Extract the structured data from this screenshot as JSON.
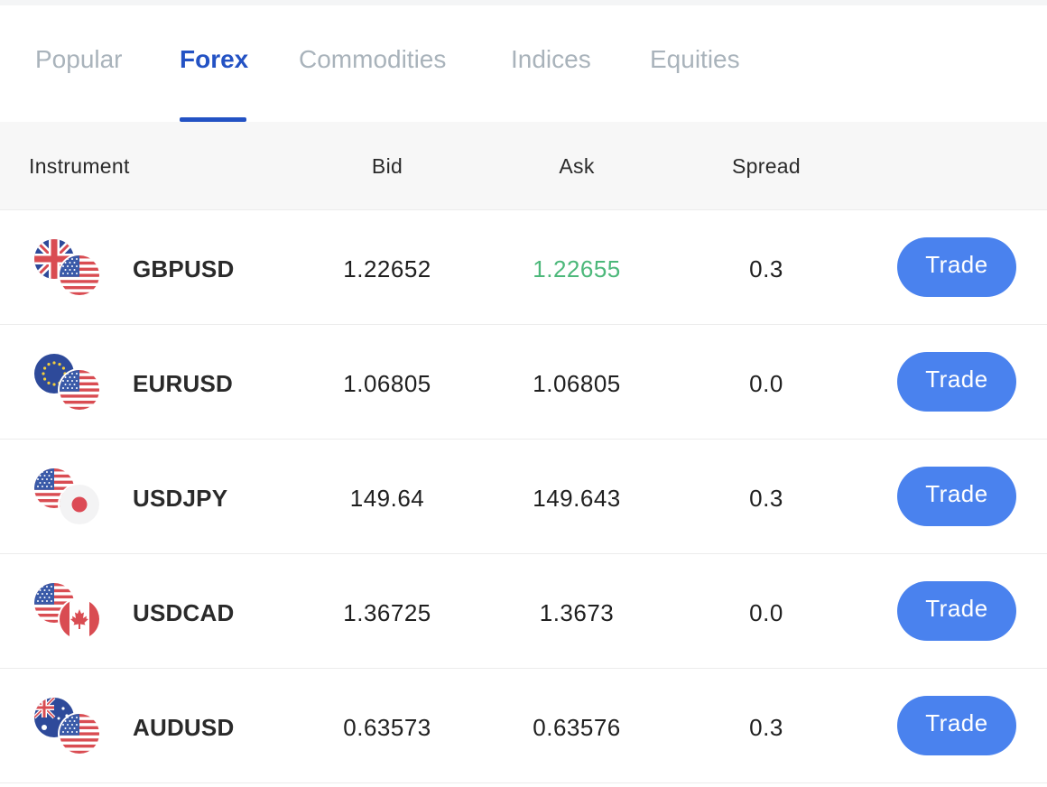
{
  "tabs": [
    {
      "label": "Popular",
      "active": false
    },
    {
      "label": "Forex",
      "active": true
    },
    {
      "label": "Commodities",
      "active": false
    },
    {
      "label": "Indices",
      "active": false
    },
    {
      "label": "Equities",
      "active": false
    }
  ],
  "table": {
    "columns": {
      "instrument": "Instrument",
      "bid": "Bid",
      "ask": "Ask",
      "spread": "Spread"
    },
    "rows": [
      {
        "symbol": "GBPUSD",
        "bid": "1.22652",
        "ask": "1.22655",
        "spread": "0.3",
        "trade_label": "Trade",
        "ask_direction": "up",
        "flags": [
          "uk-flag-icon",
          "us-flag-icon"
        ]
      },
      {
        "symbol": "EURUSD",
        "bid": "1.06805",
        "ask": "1.06805",
        "spread": "0.0",
        "trade_label": "Trade",
        "ask_direction": "none",
        "flags": [
          "eu-flag-icon",
          "us-flag-icon"
        ]
      },
      {
        "symbol": "USDJPY",
        "bid": "149.64",
        "ask": "149.643",
        "spread": "0.3",
        "trade_label": "Trade",
        "ask_direction": "none",
        "flags": [
          "us-flag-icon",
          "japan-flag-icon"
        ]
      },
      {
        "symbol": "USDCAD",
        "bid": "1.36725",
        "ask": "1.3673",
        "spread": "0.0",
        "trade_label": "Trade",
        "ask_direction": "none",
        "flags": [
          "us-flag-icon",
          "canada-flag-icon"
        ]
      },
      {
        "symbol": "AUDUSD",
        "bid": "0.63573",
        "ask": "0.63576",
        "spread": "0.3",
        "trade_label": "Trade",
        "ask_direction": "none",
        "flags": [
          "australia-flag-icon",
          "us-flag-icon"
        ]
      }
    ]
  },
  "colors": {
    "accent": "#2352c4",
    "button": "#4a82ee",
    "price_up": "#4cb87a",
    "tab_inactive": "#a9b3bb"
  }
}
